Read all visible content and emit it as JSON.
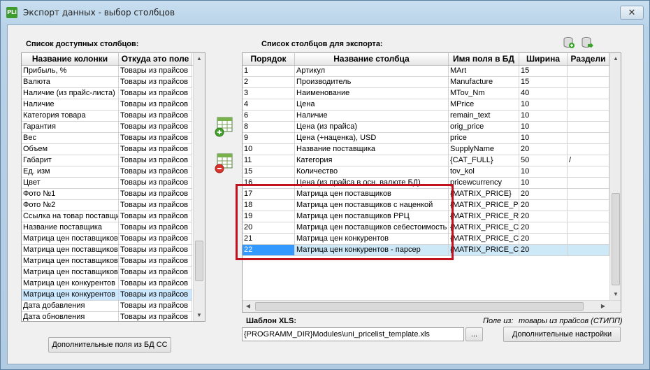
{
  "window": {
    "app_icon_text": "PLi",
    "title": "Экспорт данных - выбор столбцов",
    "close_glyph": "✕"
  },
  "left_panel": {
    "label": "Список доступных столбцов:",
    "columns": [
      "Название колонки",
      "Откуда это поле"
    ],
    "rows": [
      [
        "Прибыль, %",
        "Товары из прайсов"
      ],
      [
        "Валюта",
        "Товары из прайсов"
      ],
      [
        "Наличие (из прайс-листа)",
        "Товары из прайсов"
      ],
      [
        "Наличие",
        "Товары из прайсов"
      ],
      [
        "Категория товара",
        "Товары из прайсов"
      ],
      [
        "Гарантия",
        "Товары из прайсов"
      ],
      [
        "Вес",
        "Товары из прайсов"
      ],
      [
        "Объем",
        "Товары из прайсов"
      ],
      [
        "Габарит",
        "Товары из прайсов"
      ],
      [
        "Ед. изм",
        "Товары из прайсов"
      ],
      [
        "Цвет",
        "Товары из прайсов"
      ],
      [
        "Фото №1",
        "Товары из прайсов"
      ],
      [
        "Фото №2",
        "Товары из прайсов"
      ],
      [
        "Ссылка на товар поставщи",
        "Товары из прайсов"
      ],
      [
        "Название поставщика",
        "Товары из прайсов"
      ],
      [
        "Матрица цен поставщиков",
        "Товары из прайсов"
      ],
      [
        "Матрица цен поставщиков",
        "Товары из прайсов"
      ],
      [
        "Матрица цен поставщиков",
        "Товары из прайсов"
      ],
      [
        "Матрица цен поставщиков",
        "Товары из прайсов"
      ],
      [
        "Матрица цен конкурентов",
        "Товары из прайсов"
      ],
      [
        "Матрица цен конкурентов",
        "Товары из прайсов"
      ],
      [
        "Дата добавления",
        "Товары из прайсов"
      ],
      [
        "Дата обновления",
        "Товары из прайсов"
      ]
    ],
    "selected_index": 20,
    "extra_fields_button": "Дополнительные поля из БД СС"
  },
  "middle_icons": {
    "add": "add-column-icon",
    "remove": "remove-column-icon"
  },
  "right_panel": {
    "label": "Список столбцов для экспорта:",
    "toolbar_icons": [
      "database-add-icon",
      "database-export-icon"
    ],
    "columns": [
      "Порядок",
      "Название столбца",
      "Имя поля в БД",
      "Ширина",
      "Раздели"
    ],
    "rows": [
      [
        "1",
        "Артикул",
        "MArt",
        "15",
        ""
      ],
      [
        "2",
        "Производитель",
        "Manufacture",
        "15",
        ""
      ],
      [
        "3",
        "Наименование",
        "MTov_Nm",
        "40",
        ""
      ],
      [
        "4",
        "Цена",
        "MPrice",
        "10",
        ""
      ],
      [
        "6",
        "Наличие",
        "remain_text",
        "10",
        ""
      ],
      [
        "8",
        "Цена (из прайса)",
        "orig_price",
        "10",
        ""
      ],
      [
        "9",
        "Цена (+наценка), USD",
        "price",
        "10",
        ""
      ],
      [
        "10",
        "Название поставщика",
        "SupplyName",
        "20",
        ""
      ],
      [
        "11",
        "Категория",
        "{CAT_FULL}",
        "50",
        "/"
      ],
      [
        "15",
        "Количество",
        "tov_kol",
        "10",
        ""
      ],
      [
        "16",
        "Цена (из прайса в осн. валюте БД)",
        "pricewcurrency",
        "10",
        ""
      ],
      [
        "17",
        "Матрица цен поставщиков",
        "{MATRIX_PRICE}",
        "20",
        ""
      ],
      [
        "18",
        "Матрица цен поставщиков с наценкой",
        "{MATRIX_PRICE_PR",
        "20",
        ""
      ],
      [
        "19",
        "Матрица цен поставщиков РРЦ",
        "{MATRIX_PRICE_RR",
        "20",
        ""
      ],
      [
        "20",
        "Матрица цен поставщиков себестоимость",
        "{MATRIX_PRICE_CC",
        "20",
        ""
      ],
      [
        "21",
        "Матрица цен конкурентов",
        "{MATRIX_PRICE_CC",
        "20",
        ""
      ],
      [
        "22",
        "Матрица цен конкурентов - парсер",
        "{MATRIX_PRICE_CC",
        "20",
        ""
      ]
    ],
    "selected_index": 16
  },
  "template": {
    "label": "Шаблон XLS:",
    "path": "{PROGRAMM_DIR}Modules\\uni_pricelist_template.xls",
    "browse_label": "...",
    "fields_from_caption": "Поле из:",
    "fields_from_value": "товары из прайсов (СТИПП)",
    "additional_settings_button": "Дополнительные настройки"
  }
}
